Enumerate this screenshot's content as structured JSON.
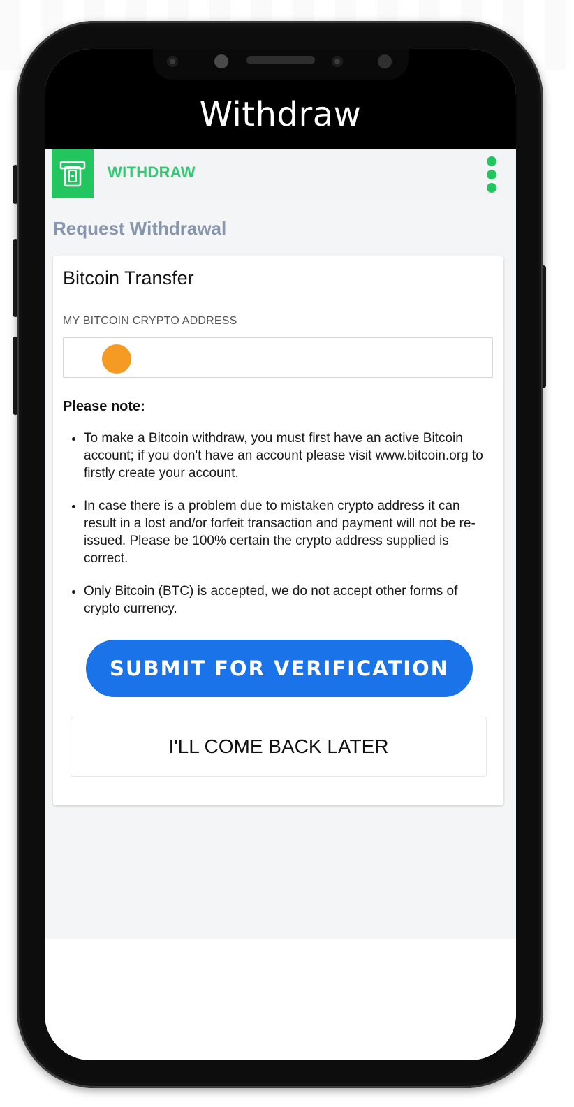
{
  "screen_title": "Withdraw",
  "appbar": {
    "icon": "atm-withdraw-icon",
    "label": "WITHDRAW",
    "menu_icon": "kebab-menu-icon"
  },
  "section_title": "Request Withdrawal",
  "card": {
    "title": "Bitcoin Transfer",
    "field_label": "MY BITCOIN CRYPTO ADDRESS",
    "field_value": "",
    "note_title": "Please note:",
    "notes": [
      "To make a Bitcoin withdraw, you must first have an active Bitcoin account; if you don't have an account please visit www.bitcoin.org to firstly create your account.",
      "In case there is a problem due to mistaken crypto address it can result in a lost and/or forfeit transaction and payment will not be re-issued. Please be 100% certain the crypto address supplied is correct.",
      "Only Bitcoin (BTC) is accepted, we do not accept other forms of crypto currency."
    ],
    "submit_label": "SUBMIT FOR VERIFICATION",
    "later_label": "I'LL COME BACK LATER"
  },
  "colors": {
    "accent_green": "#22c55e",
    "primary_blue": "#1a73e8",
    "section_title": "#8796ac",
    "cursor_dot": "#f59a23"
  }
}
